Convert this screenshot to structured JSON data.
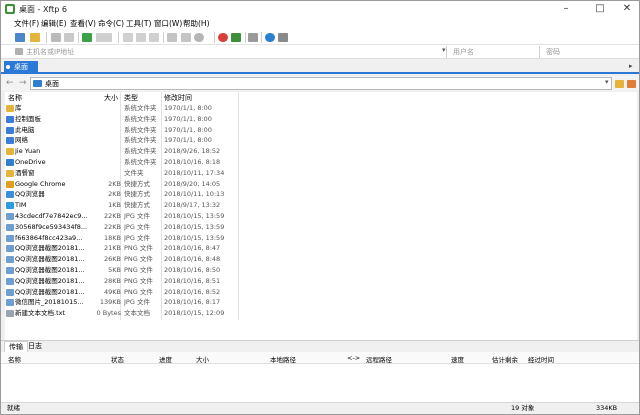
{
  "window": {
    "title": "桌面 - Xftp 6"
  },
  "menus": [
    "文件(F)",
    "编辑(E)",
    "查看(V)",
    "命令(C)",
    "工具(T)",
    "窗口(W)",
    "帮助(H)"
  ],
  "address": {
    "host_placeholder": "主机名或IP地址",
    "user_placeholder": "用户名",
    "password_placeholder": "密码"
  },
  "session_tab": {
    "label": "桌面"
  },
  "path": {
    "value": "桌面"
  },
  "file_columns": {
    "name": "名称",
    "size": "大小",
    "type": "类型",
    "modified": "修改时间"
  },
  "files": [
    {
      "name": "库",
      "size": "",
      "type": "系统文件夹",
      "modified": "1970/1/1, 8:00",
      "icon": "library-icon"
    },
    {
      "name": "控制面板",
      "size": "",
      "type": "系统文件夹",
      "modified": "1970/1/1, 8:00",
      "icon": "control-panel-icon"
    },
    {
      "name": "此电脑",
      "size": "",
      "type": "系统文件夹",
      "modified": "1970/1/1, 8:00",
      "icon": "computer-icon"
    },
    {
      "name": "网络",
      "size": "",
      "type": "系统文件夹",
      "modified": "1970/1/1, 8:00",
      "icon": "network-icon"
    },
    {
      "name": "Jie Yuan",
      "size": "",
      "type": "系统文件夹",
      "modified": "2018/9/26, 18:52",
      "icon": "user-folder-icon"
    },
    {
      "name": "OneDrive",
      "size": "",
      "type": "系统文件夹",
      "modified": "2018/10/16, 8:18",
      "icon": "onedrive-icon"
    },
    {
      "name": "酒餐窗",
      "size": "",
      "type": "文件夹",
      "modified": "2018/10/11, 17:34",
      "icon": "folder-icon"
    },
    {
      "name": "Google Chrome",
      "size": "2KB",
      "type": "快捷方式",
      "modified": "2018/9/20, 14:05",
      "icon": "chrome-icon"
    },
    {
      "name": "QQ浏览器",
      "size": "2KB",
      "type": "快捷方式",
      "modified": "2018/10/11, 10:13",
      "icon": "qq-browser-icon"
    },
    {
      "name": "TIM",
      "size": "1KB",
      "type": "快捷方式",
      "modified": "2018/9/17, 13:32",
      "icon": "tim-icon"
    },
    {
      "name": "43cdecdf7e7842ec9...",
      "size": "22KB",
      "type": "JPG 文件",
      "modified": "2018/10/15, 13:59",
      "icon": "image-file-icon"
    },
    {
      "name": "30568f9ce593434f8...",
      "size": "22KB",
      "type": "JPG 文件",
      "modified": "2018/10/15, 13:59",
      "icon": "image-file-icon"
    },
    {
      "name": "f663864f8cc423a9...",
      "size": "18KB",
      "type": "JPG 文件",
      "modified": "2018/10/15, 13:59",
      "icon": "image-file-icon"
    },
    {
      "name": "QQ浏览器截图20181...",
      "size": "21KB",
      "type": "PNG 文件",
      "modified": "2018/10/16, 8:47",
      "icon": "image-file-icon"
    },
    {
      "name": "QQ浏览器截图20181...",
      "size": "26KB",
      "type": "PNG 文件",
      "modified": "2018/10/16, 8:48",
      "icon": "image-file-icon"
    },
    {
      "name": "QQ浏览器截图20181...",
      "size": "5KB",
      "type": "PNG 文件",
      "modified": "2018/10/16, 8:50",
      "icon": "image-file-icon"
    },
    {
      "name": "QQ浏览器截图20181...",
      "size": "28KB",
      "type": "PNG 文件",
      "modified": "2018/10/16, 8:51",
      "icon": "image-file-icon"
    },
    {
      "name": "QQ浏览器截图20181...",
      "size": "49KB",
      "type": "PNG 文件",
      "modified": "2018/10/16, 8:52",
      "icon": "image-file-icon"
    },
    {
      "name": "微信图片_20181015...",
      "size": "139KB",
      "type": "JPG 文件",
      "modified": "2018/10/16, 8:17",
      "icon": "image-file-icon"
    },
    {
      "name": "新建文本文档.txt",
      "size": "0 Bytes",
      "type": "文本文档",
      "modified": "2018/10/15, 12:09",
      "icon": "text-file-icon"
    }
  ],
  "bottom_tabs": [
    "传输",
    "日志"
  ],
  "transfer_columns": [
    "名称",
    "状态",
    "进度",
    "大小",
    "本地路径",
    "<->",
    "远程路径",
    "速度",
    "估计剩余",
    "经过时间"
  ],
  "status": {
    "left": "就绪",
    "count": "19 对象",
    "size": "334KB"
  }
}
